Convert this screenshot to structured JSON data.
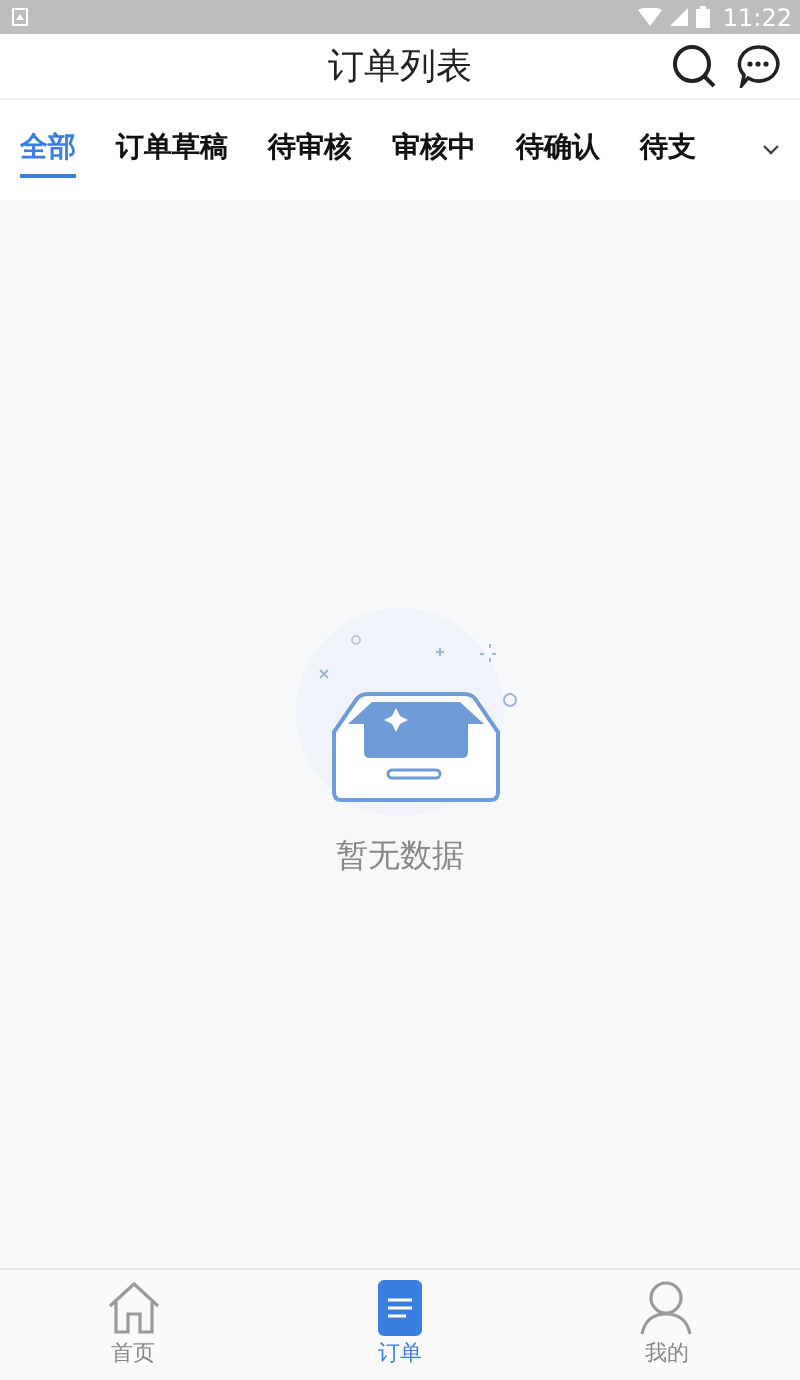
{
  "status_bar": {
    "time": "11:22"
  },
  "header": {
    "title": "订单列表"
  },
  "tabs": [
    {
      "label": "全部",
      "selected": true
    },
    {
      "label": "订单草稿",
      "selected": false
    },
    {
      "label": "待审核",
      "selected": false
    },
    {
      "label": "审核中",
      "selected": false
    },
    {
      "label": "待确认",
      "selected": false
    },
    {
      "label": "待支",
      "selected": false
    }
  ],
  "empty_state": {
    "message": "暂无数据"
  },
  "bottom_nav": [
    {
      "label": "首页",
      "kind": "home",
      "selected": false
    },
    {
      "label": "订单",
      "kind": "order",
      "selected": true
    },
    {
      "label": "我的",
      "kind": "user",
      "selected": false
    }
  ]
}
